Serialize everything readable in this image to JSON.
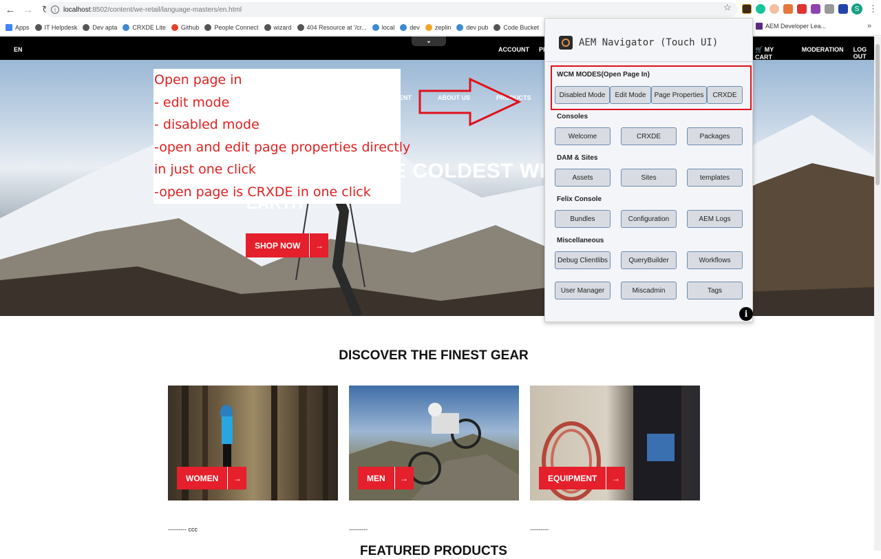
{
  "browser": {
    "url_host": "localhost",
    "url_path": ":8502/content/we-retail/language-masters/en.html",
    "profile_initial": "S",
    "bookmarks": [
      "Apps",
      "IT Helpdesk",
      "Dev apta",
      "CRXDE Lite",
      "Github",
      "People Connect",
      "wizard",
      "404 Resource at '/cr...",
      "local",
      "dev",
      "zeplin",
      "dev pub",
      "Code Bucket"
    ],
    "bookmark_right": "AEM Developer Lea..."
  },
  "site": {
    "lang": "EN",
    "top_links": [
      "ACCOUNT",
      "PRO",
      "MY CART",
      "MODERATION",
      "LOG OUT"
    ],
    "nav_items": [
      "ENT",
      "ABOUT US",
      "PRODUCTS"
    ],
    "hero_title": "E COLDEST WI",
    "hero_title2": "EARTH",
    "shop_now": "SHOP NOW",
    "arrow": "→",
    "discover": "DISCOVER THE FINEST GEAR",
    "cards": [
      {
        "label": "WOMEN",
        "caption": "--------- ccc"
      },
      {
        "label": "MEN",
        "caption": "---------"
      },
      {
        "label": "EQUIPMENT",
        "caption": "---------"
      }
    ],
    "featured": "FEATURED PRODUCTS"
  },
  "annotation": [
    "Open page in",
    "- edit mode",
    "- disabled mode",
    "-open and edit page properties directly",
    "in just one click",
    "-open page is CRXDE in one click"
  ],
  "navigator": {
    "title": "AEM Navigator (Touch UI)",
    "sections": {
      "wcm": {
        "label": "WCM MODES(Open Page In)",
        "buttons": [
          "Disabled Mode",
          "Edit Mode",
          "Page Properties",
          "CRXDE"
        ]
      },
      "consoles": {
        "label": "Consoles",
        "buttons": [
          "Welcome",
          "CRXDE",
          "Packages"
        ]
      },
      "dam": {
        "label": "DAM & Sites",
        "buttons": [
          "Assets",
          "Sites",
          "templates"
        ]
      },
      "felix": {
        "label": "Felix Console",
        "buttons": [
          "Bundles",
          "Configuration",
          "AEM Logs"
        ]
      },
      "misc": {
        "label": "Miscellaneous",
        "buttons": [
          "Debug Clientlibs",
          "QueryBuilder",
          "Workflows",
          "User Manager",
          "Miscadmin",
          "Tags"
        ]
      }
    },
    "info": "i"
  },
  "colors": {
    "accent_red": "#e51f2b",
    "highlight_red": "#e0101a"
  }
}
